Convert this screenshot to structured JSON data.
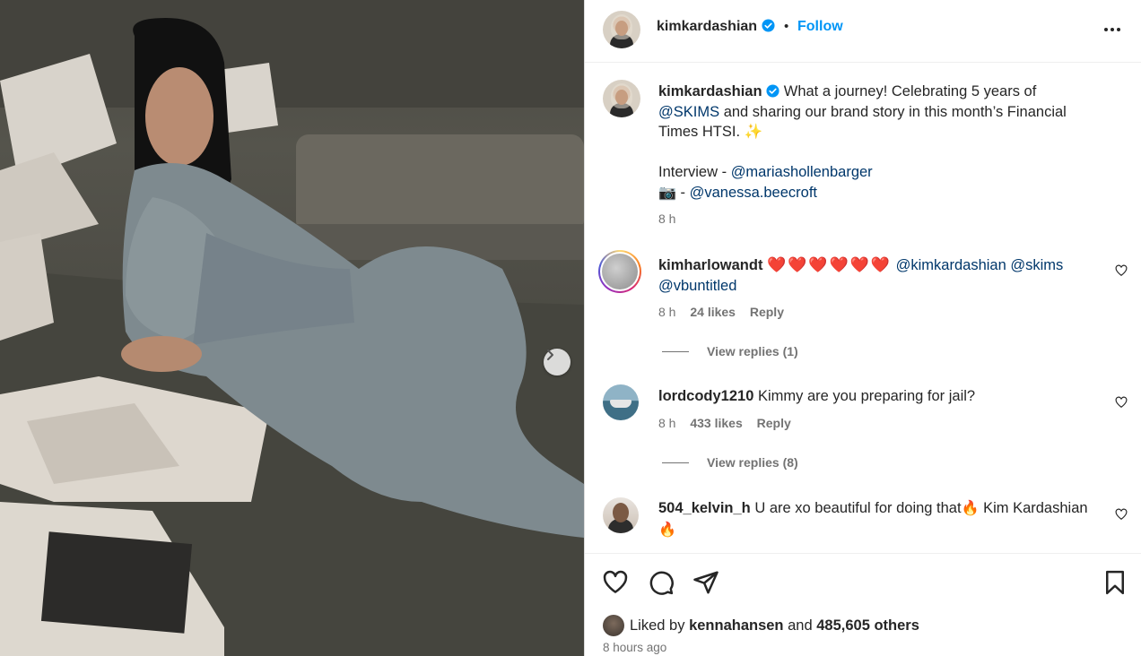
{
  "post_image": {
    "alt_icon": "photo",
    "next_icon": "chevron-right-icon"
  },
  "header": {
    "username": "kimkardashian",
    "separator": "•",
    "follow_label": "Follow",
    "more_icon": "more-horizontal-icon"
  },
  "caption": {
    "username": "kimkardashian",
    "text_part1": "What a journey! Celebrating 5 years of ",
    "mention1": "@SKIMS",
    "text_part2": " and sharing our brand story in this month’s Financial Times HTSI. ✨",
    "interview_label": "Interview - ",
    "mention2": "@mariashollenbarger",
    "camera_emoji": "📷",
    "camera_sep": " - ",
    "mention3": "@vanessa.beecroft",
    "time": "8 h"
  },
  "comments": [
    {
      "username": "kimharlowandt",
      "hearts": "❤️❤️❤️❤️❤️❤️",
      "mention1": "@kimkardashian",
      "mention2": "@skims",
      "mention3": "@vbuntitled",
      "time": "8 h",
      "likes": "24 likes",
      "reply": "Reply",
      "view_replies": "View replies (1)"
    },
    {
      "username": "lordcody1210",
      "text": "Kimmy are you preparing for jail?",
      "time": "8 h",
      "likes": "433 likes",
      "reply": "Reply",
      "view_replies": "View replies (8)"
    },
    {
      "username": "504_kelvin_h",
      "text": "U are xo beautiful for doing that",
      "emoji1": "🔥",
      "text2": " Kim Kardashian ",
      "emoji2": "🔥"
    }
  ],
  "actions": {
    "like_icon": "heart-icon",
    "comment_icon": "comment-icon",
    "share_icon": "share-icon",
    "save_icon": "bookmark-icon"
  },
  "likes_summary": {
    "prefix": "Liked by ",
    "user": "kennahansen",
    "middle": " and ",
    "count": "485,605 others"
  },
  "posted_time": "8 hours ago",
  "colors": {
    "accent": "#0095f6",
    "mention": "#00376b",
    "muted": "#737373",
    "heart_red": "#ed1b2e"
  }
}
